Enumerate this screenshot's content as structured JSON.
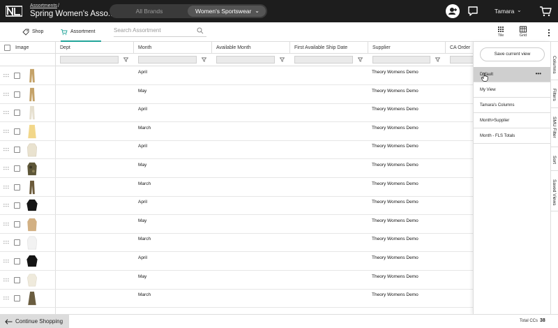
{
  "header": {
    "breadcrumb": "Assortments",
    "breadcrumb_sep": "/",
    "title": "Spring Women's Asso...",
    "segment_all": "All Brands",
    "segment_selected": "Women's Sportswear",
    "user_name": "Tamara",
    "icons": [
      "add-user-icon",
      "chat-icon",
      "chevron-down-icon",
      "cart-icon"
    ]
  },
  "toolbar": {
    "shop_label": "Shop",
    "assortment_label": "Assortment",
    "search_placeholder": "Search Assortment",
    "tile_label": "Tile",
    "grid_label": "Grid"
  },
  "grid": {
    "columns": [
      "Image",
      "Dept",
      "Month",
      "Available Month",
      "First Available Ship Date",
      "Supplier",
      "CA Order"
    ],
    "rows": [
      {
        "month": "April",
        "supplier": "Theory Womens Demo",
        "thumb": "pants-tan"
      },
      {
        "month": "May",
        "supplier": "Theory Womens Demo",
        "thumb": "pants-tan"
      },
      {
        "month": "April",
        "supplier": "Theory Womens Demo",
        "thumb": "pants-cream"
      },
      {
        "month": "March",
        "supplier": "Theory Womens Demo",
        "thumb": "skirt-yellow"
      },
      {
        "month": "April",
        "supplier": "Theory Womens Demo",
        "thumb": "jacket-cream"
      },
      {
        "month": "May",
        "supplier": "Theory Womens Demo",
        "thumb": "jacket-camo"
      },
      {
        "month": "March",
        "supplier": "Theory Womens Demo",
        "thumb": "pants-olive"
      },
      {
        "month": "April",
        "supplier": "Theory Womens Demo",
        "thumb": "jacket-black"
      },
      {
        "month": "May",
        "supplier": "Theory Womens Demo",
        "thumb": "jacket-camel"
      },
      {
        "month": "March",
        "supplier": "Theory Womens Demo",
        "thumb": "shirt-white"
      },
      {
        "month": "April",
        "supplier": "Theory Womens Demo",
        "thumb": "jacket-black"
      },
      {
        "month": "May",
        "supplier": "Theory Womens Demo",
        "thumb": "blouse-cream"
      },
      {
        "month": "March",
        "supplier": "Theory Womens Demo",
        "thumb": "dress-olive"
      }
    ]
  },
  "saved_views": {
    "save_button": "Save current view",
    "views": [
      "Default",
      "My View",
      "Tamara's Columns",
      "Month>Supplier",
      "Month - FLS Totals"
    ],
    "selected": "Default"
  },
  "rail": [
    "Columns",
    "Filters",
    "SMU Filter",
    "Sort",
    "Saved Views"
  ],
  "footer": {
    "continue_label": "Continue Shopping",
    "total_label": "Total CCs",
    "total_value": "38"
  },
  "colors": {
    "header_bg": "#1d1d1d",
    "accent": "#22a59a",
    "selected_view_bg": "#cfcfcf"
  }
}
